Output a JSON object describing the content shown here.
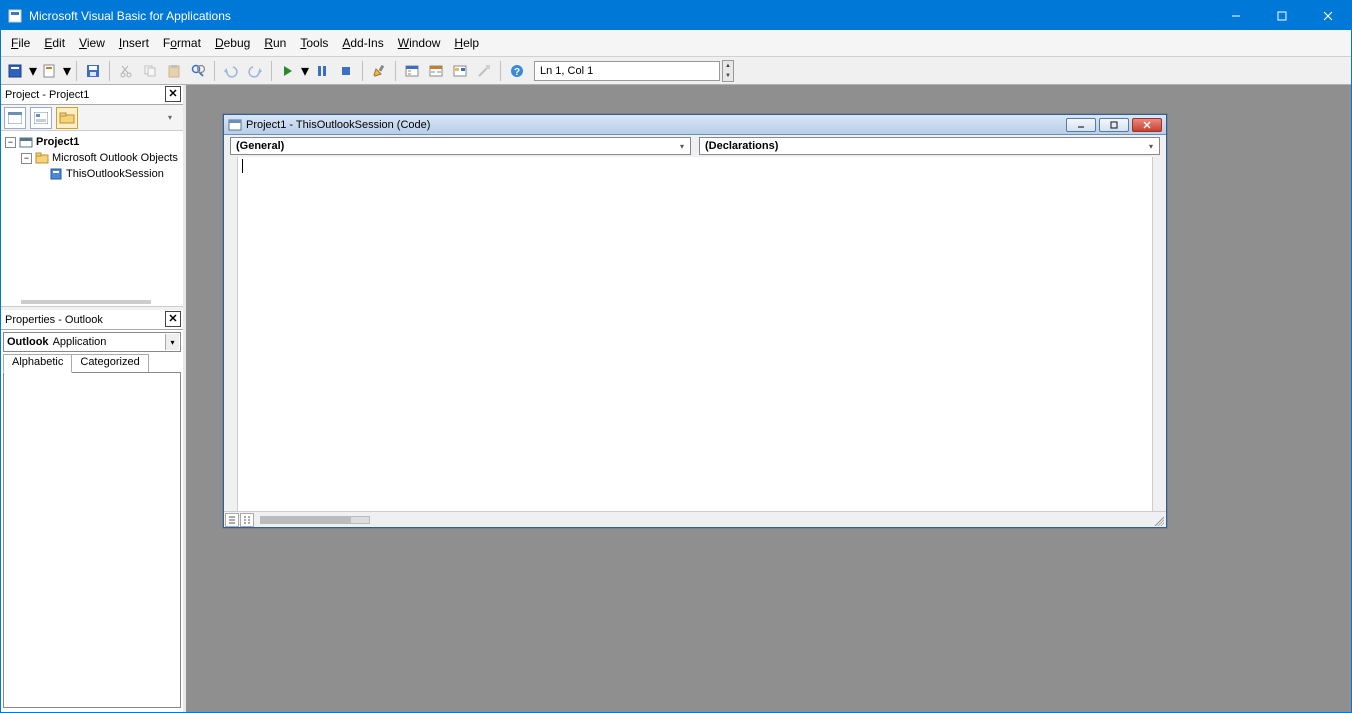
{
  "titlebar": {
    "title": "Microsoft Visual Basic for Applications"
  },
  "menu": {
    "file": "File",
    "edit": "Edit",
    "view": "View",
    "insert": "Insert",
    "format": "Format",
    "debug": "Debug",
    "run": "Run",
    "tools": "Tools",
    "addins": "Add-Ins",
    "window": "Window",
    "help": "Help"
  },
  "toolbar": {
    "cursor_pos": "Ln 1, Col 1"
  },
  "project_panel": {
    "title": "Project - Project1",
    "root": "Project1",
    "group": "Microsoft Outlook Objects",
    "item": "ThisOutlookSession"
  },
  "properties_panel": {
    "title": "Properties - Outlook",
    "obj_name": "Outlook",
    "obj_type": "Application",
    "tabs": {
      "alpha": "Alphabetic",
      "cat": "Categorized"
    }
  },
  "code_window": {
    "title": "Project1 - ThisOutlookSession (Code)",
    "combo_left": "(General)",
    "combo_right": "(Declarations)"
  }
}
